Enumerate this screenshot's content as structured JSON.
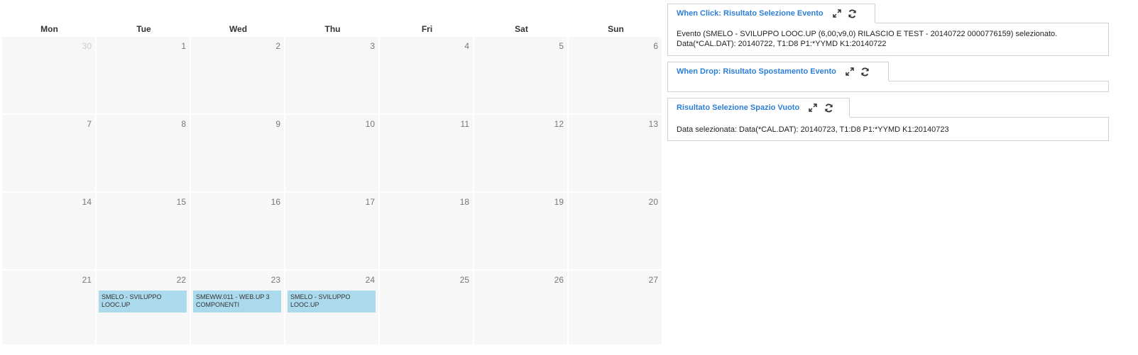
{
  "calendar": {
    "weekdays": [
      "Mon",
      "Tue",
      "Wed",
      "Thu",
      "Fri",
      "Sat",
      "Sun"
    ],
    "days": [
      {
        "num": "30",
        "other_month": true
      },
      {
        "num": "1"
      },
      {
        "num": "2"
      },
      {
        "num": "3"
      },
      {
        "num": "4"
      },
      {
        "num": "5"
      },
      {
        "num": "6"
      },
      {
        "num": "7"
      },
      {
        "num": "8"
      },
      {
        "num": "9"
      },
      {
        "num": "10"
      },
      {
        "num": "11"
      },
      {
        "num": "12"
      },
      {
        "num": "13"
      },
      {
        "num": "14"
      },
      {
        "num": "15"
      },
      {
        "num": "16"
      },
      {
        "num": "17"
      },
      {
        "num": "18"
      },
      {
        "num": "19"
      },
      {
        "num": "20"
      },
      {
        "num": "21"
      },
      {
        "num": "22",
        "event": "SMELO - SVILUPPO LOOC.UP"
      },
      {
        "num": "23",
        "event": "SMEWW.011 - WEB.UP 3 COMPONENTI"
      },
      {
        "num": "24",
        "event": "SMELO - SVILUPPO LOOC.UP"
      },
      {
        "num": "25"
      },
      {
        "num": "26"
      },
      {
        "num": "27"
      }
    ],
    "colors": {
      "cell_bg": "#f7f7f7",
      "event_bg": "#abdaed",
      "day_number": "#777777",
      "other_month_number": "#cccccc"
    }
  },
  "panels": {
    "click": {
      "title": "When Click: Risultato Selezione Evento",
      "line1": "Evento (SMELO - SVILUPPO LOOC.UP (6,00;v9,0) RILASCIO E TEST - 20140722 0000776159) selezionato.",
      "line2": "Data(*CAL.DAT): 20140722, T1:D8 P1:*YYMD K1:20140722"
    },
    "drop": {
      "title": "When Drop: Risultato Spostamento Evento",
      "text": ""
    },
    "empty": {
      "title": "Risultato Selezione Spazio Vuoto",
      "text": "Data selezionata: Data(*CAL.DAT): 20140723, T1:D8 P1:*YYMD K1:20140723"
    },
    "icons": [
      "expand-icon",
      "refresh-icon"
    ],
    "title_color": "#2d7ed6"
  }
}
